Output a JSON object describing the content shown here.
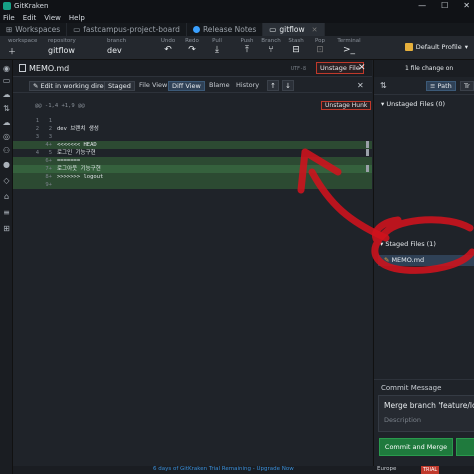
{
  "window": {
    "title": "GitKraken",
    "controls": [
      "—",
      "☐",
      "✕"
    ]
  },
  "menu": [
    "File",
    "Edit",
    "View",
    "Help"
  ],
  "tabs": [
    {
      "label": "Workspaces",
      "active": false
    },
    {
      "label": "fastcampus-project-board",
      "active": false
    },
    {
      "label": "Release Notes",
      "active": false
    },
    {
      "label": "gitflow",
      "active": true
    }
  ],
  "toolbar": {
    "workspace_label": "workspace",
    "repository_label": "repository",
    "repository_value": "gitflow",
    "branch_label": "branch",
    "branch_value": "dev",
    "buttons": [
      "Undo",
      "Redo",
      "Pull",
      "Push",
      "Branch",
      "Stash",
      "Pop",
      "Terminal"
    ],
    "profile": "Default Profile"
  },
  "diff": {
    "filename": "MEMO.md",
    "encoding": "UTF-8",
    "unstage_file": "Unstage File",
    "edit_in_wd": "Edit in working directory",
    "staged": "Staged",
    "file_view": "File View",
    "diff_view": "Diff View",
    "blame": "Blame",
    "history": "History",
    "hunk_header": "@@ -1,4 +1,9 @@",
    "unstage_hunk": "Unstage Hunk",
    "lines": [
      {
        "old": "1",
        "new": "1",
        "text": "",
        "kind": "ctx"
      },
      {
        "old": "2",
        "new": "2",
        "text": "dev 브랜치 생성",
        "kind": "ctx"
      },
      {
        "old": "3",
        "new": "3",
        "text": "",
        "kind": "ctx"
      },
      {
        "old": "",
        "new": "4+",
        "text": "<<<<<<< HEAD",
        "kind": "add"
      },
      {
        "old": "4",
        "new": "5",
        "text": "로그인 기능구현",
        "kind": "ctx"
      },
      {
        "old": "",
        "new": "6+",
        "text": "=======",
        "kind": "add"
      },
      {
        "old": "",
        "new": "7+",
        "text": "로그아웃 기능구현",
        "kind": "addstrong"
      },
      {
        "old": "",
        "new": "8+",
        "text": ">>>>>>> logout",
        "kind": "add"
      },
      {
        "old": "",
        "new": "9+",
        "text": "",
        "kind": "add"
      }
    ]
  },
  "right_panel": {
    "summary": "1 file change on",
    "path": "Path",
    "tree": "Tr",
    "unstaged_header": "Unstaged Files (0)",
    "staged_header": "Staged Files (1)",
    "staged_files": [
      "MEMO.md"
    ],
    "commit_message_label": "Commit Message",
    "commit_summary": "Merge branch 'feature/log",
    "commit_description_placeholder": "Description",
    "commit_button": "Commit and Merge"
  },
  "statusbar": {
    "trial": "6 days of GitKraken Trial Remaining - Upgrade Now",
    "zoom": "Europe",
    "badge": "TRIAL"
  },
  "colors": {
    "annotation": "#d0121c",
    "added_line": "#2c4a32",
    "commit_button": "#1f7a3d"
  }
}
